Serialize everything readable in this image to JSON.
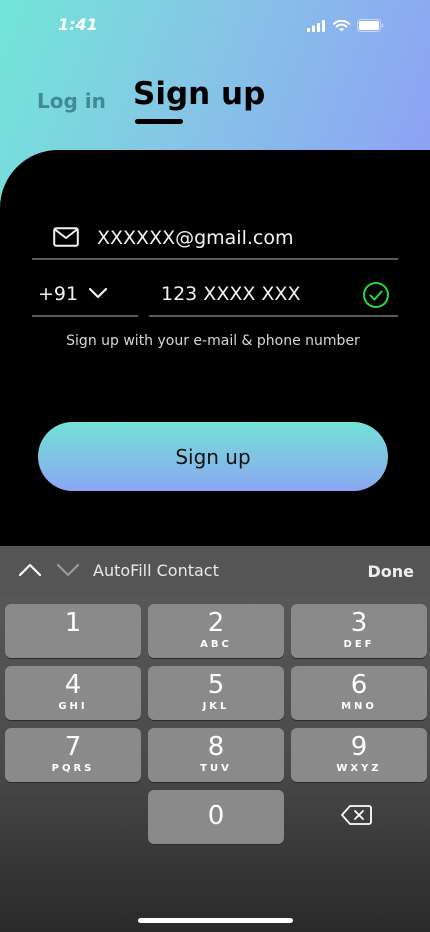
{
  "status": {
    "time": "1:41",
    "icons": [
      "cellular-signal-icon",
      "wifi-icon",
      "battery-icon"
    ]
  },
  "tabs": {
    "login": "Log in",
    "signup": "Sign up"
  },
  "form": {
    "email_value": "XXXXXX@gmail.com",
    "country_code": "+91",
    "phone_value": "123 XXXX XXX",
    "hint": "Sign up with your e-mail & phone number",
    "submit_label": "Sign up"
  },
  "keyboard": {
    "autofill_label": "AutoFill Contact",
    "done_label": "Done",
    "keys": [
      {
        "num": "1",
        "letters": ""
      },
      {
        "num": "2",
        "letters": "ABC"
      },
      {
        "num": "3",
        "letters": "DEF"
      },
      {
        "num": "4",
        "letters": "GHI"
      },
      {
        "num": "5",
        "letters": "JKL"
      },
      {
        "num": "6",
        "letters": "MNO"
      },
      {
        "num": "7",
        "letters": "PQRS"
      },
      {
        "num": "8",
        "letters": "TUV"
      },
      {
        "num": "9",
        "letters": "WXYZ"
      },
      {
        "num": "0",
        "letters": ""
      }
    ]
  },
  "colors": {
    "gradient_start": "#72e6d8",
    "gradient_end": "#8e9ff6",
    "valid_check": "#2bd43a",
    "login_tab": "#3f8a95"
  }
}
